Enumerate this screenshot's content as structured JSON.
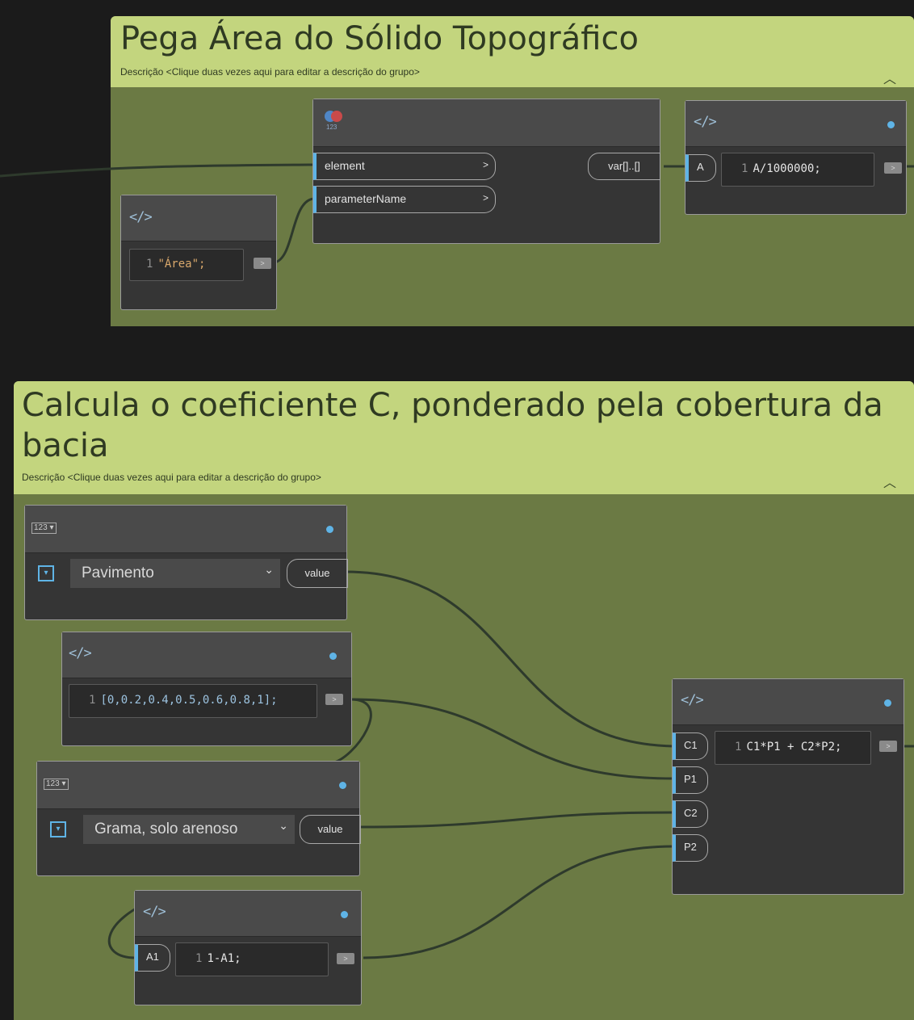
{
  "group1": {
    "title": "Pega Área do Sólido Topográfico",
    "description": "Descrição <Clique duas vezes aqui para editar a descrição do grupo>",
    "collapse_icon": "chevron-up-icon"
  },
  "group2": {
    "title_line1": "Calcula o coeficiente C, ponderado pela cobertura da",
    "title_line2": "bacia",
    "description": "Descrição <Clique duas vezes aqui para editar a descrição do grupo>",
    "collapse_icon": "chevron-up-icon"
  },
  "nodes": {
    "get_parameter": {
      "icon_label": "123",
      "inputs": [
        "element",
        "parameterName"
      ],
      "output": "var[]..[]"
    },
    "area_string": {
      "icon": "</>",
      "line_no": "1",
      "code": "\"Área\";"
    },
    "divide_area": {
      "icon": "</>",
      "input": "A",
      "line_no": "1",
      "code": "A/1000000;"
    },
    "dropdown1": {
      "icon_label": "123",
      "selected": "Pavimento",
      "output": "value"
    },
    "list_code": {
      "icon": "</>",
      "line_no": "1",
      "code": "[0,0.2,0.4,0.5,0.6,0.8,1];"
    },
    "dropdown2": {
      "icon_label": "123",
      "selected": "Grama, solo arenoso",
      "output": "value"
    },
    "complement": {
      "icon": "</>",
      "input": "A1",
      "line_no": "1",
      "code": "1-A1;"
    },
    "weighted_c": {
      "icon": "</>",
      "inputs": [
        "C1",
        "P1",
        "C2",
        "P2"
      ],
      "line_no": "1",
      "code": "C1*P1 + C2*P2;"
    }
  },
  "output_button": ">",
  "colors": {
    "background": "#1b1b1b",
    "group_body": "#6b7a44",
    "group_header": "#c3d57e",
    "node": "#353535",
    "accent": "#5fb4e6"
  }
}
